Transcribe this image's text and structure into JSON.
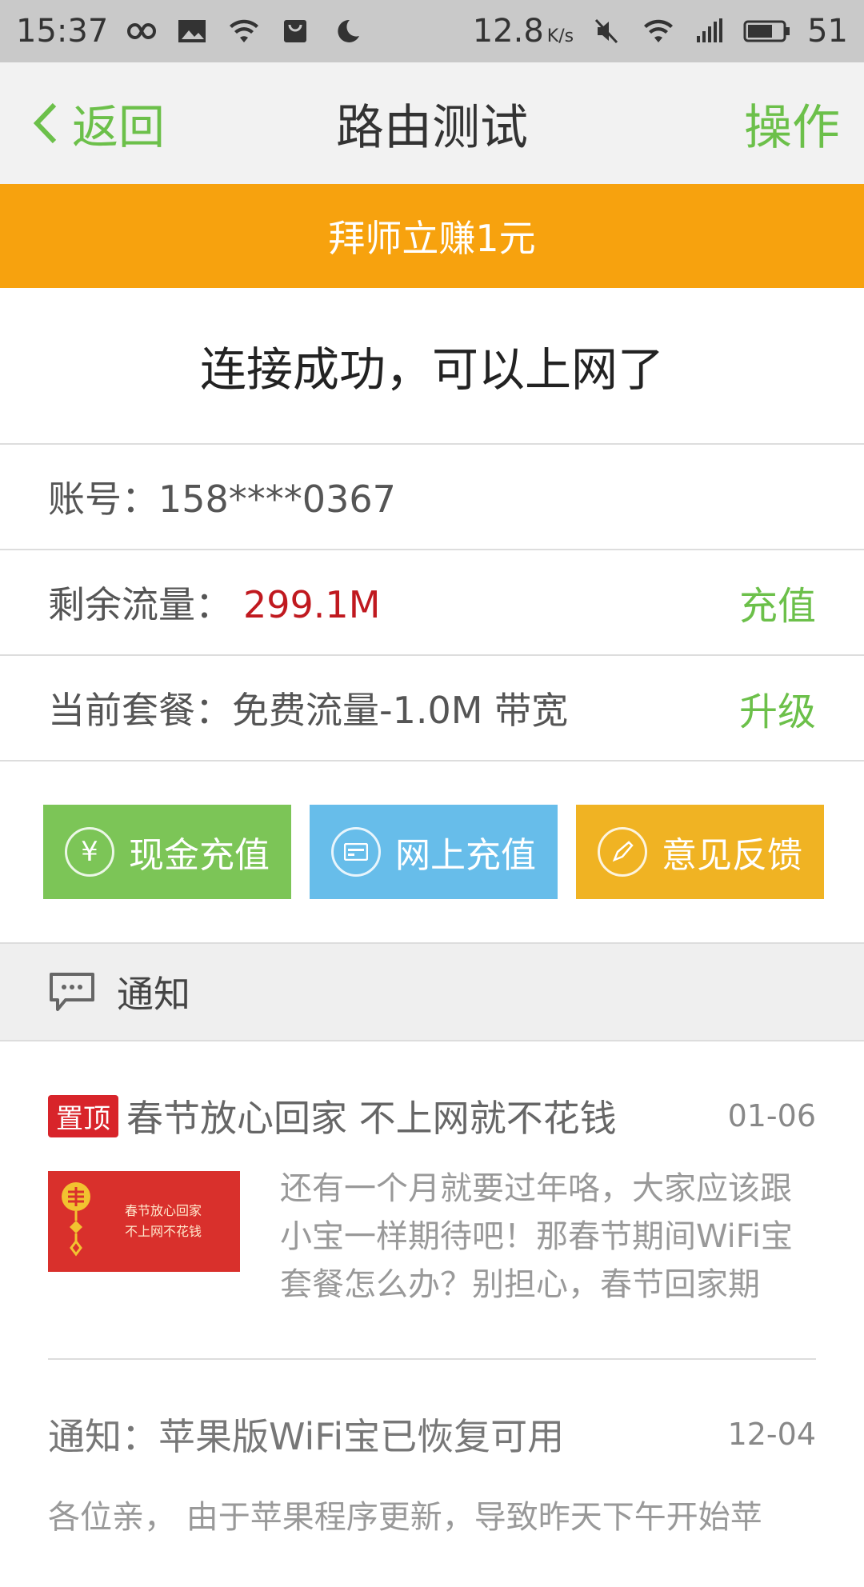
{
  "status_bar": {
    "time": "15:37",
    "speed": "12.8",
    "speed_unit": "K/s",
    "battery": "51"
  },
  "nav": {
    "back_label": "返回",
    "title": "路由测试",
    "action_label": "操作"
  },
  "banner": {
    "text": "拜师立赚1元"
  },
  "connect_message": "连接成功，可以上网了",
  "account": {
    "label": "账号：",
    "value": "158****0367"
  },
  "traffic": {
    "label": "剩余流量：",
    "value": "299.1M",
    "action": "充值"
  },
  "plan": {
    "label": "当前套餐：免费流量-1.0M 带宽",
    "action": "升级"
  },
  "actions": [
    {
      "label": "现金充值",
      "icon": "yuan-icon"
    },
    {
      "label": "网上充值",
      "icon": "card-icon"
    },
    {
      "label": "意见反馈",
      "icon": "pen-icon"
    }
  ],
  "notice_section": {
    "title": "通知"
  },
  "news": [
    {
      "badge": "置顶",
      "title": "春节放心回家 不上网就不花钱",
      "date": "01-06",
      "thumb_text": [
        "春节放心回家",
        "不上网不花钱"
      ],
      "body": "还有一个月就要过年咯，大家应该跟小宝一样期待吧！那春节期间WiFi宝套餐怎么办？别担心，春节回家期"
    },
    {
      "title": "通知：苹果版WiFi宝已恢复可用",
      "date": "12-04",
      "body": "各位亲， 由于苹果程序更新，导致昨天下午开始苹"
    }
  ],
  "colors": {
    "accent_green": "#6cc04a",
    "banner_orange": "#f7a20e",
    "value_red": "#c0191f",
    "btn_green": "#7cc557",
    "btn_blue": "#67bdea",
    "btn_yellow": "#f0b323",
    "badge_red": "#d8242a"
  }
}
